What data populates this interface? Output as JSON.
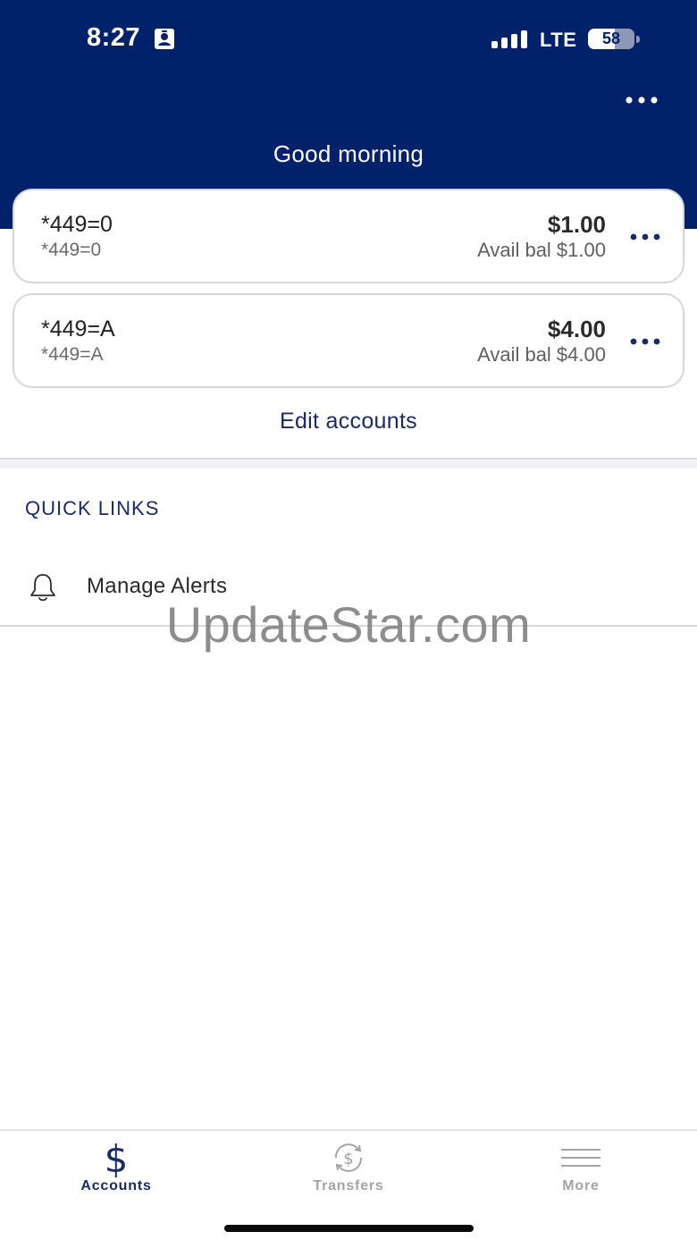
{
  "status_bar": {
    "time": "8:27",
    "network": "LTE",
    "battery": "58",
    "battery_level": 0.58,
    "icons": [
      "id-card-icon",
      "signal-icon",
      "battery-icon"
    ]
  },
  "header": {
    "more_icon": "more-horizontal-icon",
    "greeting": "Good morning"
  },
  "accounts": [
    {
      "name": "*449=0",
      "sub": "*449=0",
      "balance": "$1.00",
      "avail": "Avail bal $1.00"
    },
    {
      "name": "*449=A",
      "sub": "*449=A",
      "balance": "$4.00",
      "avail": "Avail bal $4.00"
    }
  ],
  "edit_accounts": "Edit accounts",
  "quick_links": {
    "title": "QUICK LINKS",
    "items": [
      {
        "label": "Manage Alerts",
        "icon": "bell-icon"
      }
    ]
  },
  "watermark": "UpdateStar.com",
  "tabbar": {
    "tabs": [
      {
        "label": "Accounts",
        "icon": "dollar-icon",
        "active": true
      },
      {
        "label": "Transfers",
        "icon": "transfer-icon",
        "active": false
      },
      {
        "label": "More",
        "icon": "menu-icon",
        "active": false
      }
    ]
  },
  "colors": {
    "brand_navy": "#02216b",
    "link_navy": "#1a2a64",
    "inactive_gray": "#a3a3a8"
  }
}
